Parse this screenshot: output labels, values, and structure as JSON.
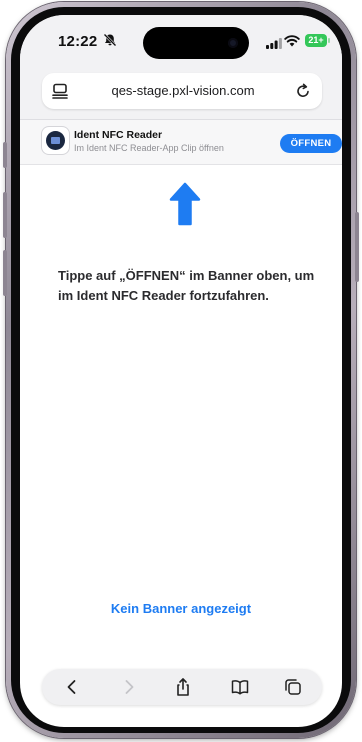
{
  "status_bar": {
    "time": "12:22",
    "battery": "21+"
  },
  "browser": {
    "url": "qes-stage.pxl-vision.com"
  },
  "app_clip_banner": {
    "title": "Ident NFC Reader",
    "subtitle": "Im Ident NFC Reader-App Clip öffnen",
    "open_label": "ÖFFNEN"
  },
  "content": {
    "instruction": "Tippe auf „ÖFFNEN“ im Banner oben, um im Ident NFC Reader fortzufahren.",
    "no_banner_link": "Kein Banner angezeigt"
  },
  "toolbar": {
    "icons": [
      "back-icon",
      "forward-icon",
      "share-icon",
      "bookmarks-icon",
      "tabs-icon"
    ]
  },
  "colors": {
    "accent": "#1e7cf2",
    "battery": "#34c759"
  }
}
